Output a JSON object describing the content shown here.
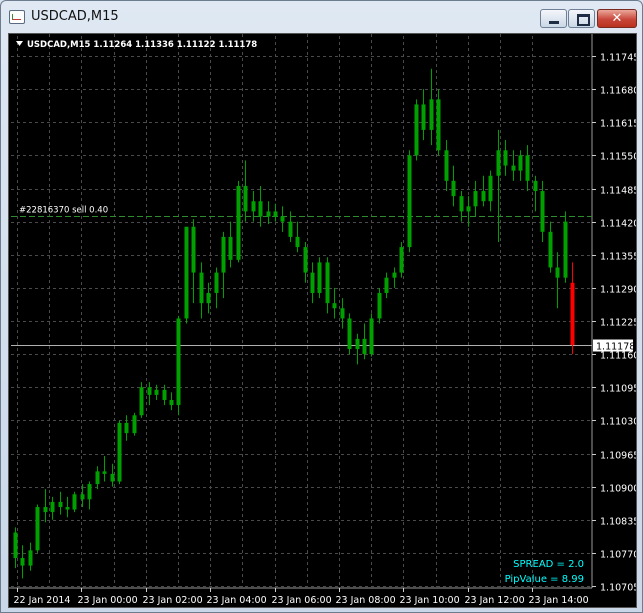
{
  "window": {
    "title": "USDCAD,M15"
  },
  "header": {
    "symbol_line": "USDCAD,M15  1.11264 1.11336 1.11122 1.11178"
  },
  "order_line": {
    "label": "#22816370 sell 0.40",
    "price": 1.11432
  },
  "bid_line": {
    "price": 1.11178,
    "label": "1.11178"
  },
  "info": {
    "spread": "SPREAD = 2.0",
    "pip_value": "PipValue = 8.99"
  },
  "colors": {
    "background": "#000000",
    "bull": "#00a000",
    "bear": "#00a000",
    "last_bear": "#ff0000",
    "grid": "#4a4a4a",
    "text": "#ffffff",
    "info": "#00ffff"
  },
  "chart_data": {
    "type": "candlestick",
    "y_ticks": [
      "1.11745",
      "1.11680",
      "1.11615",
      "1.11550",
      "1.11485",
      "1.11420",
      "1.11355",
      "1.11290",
      "1.11225",
      "1.11160",
      "1.11095",
      "1.11030",
      "1.10965",
      "1.10900",
      "1.10835",
      "1.10770",
      "1.10705"
    ],
    "x_ticks": [
      "22 Jan 2014",
      "23 Jan 00:00",
      "23 Jan 02:00",
      "23 Jan 04:00",
      "23 Jan 06:00",
      "23 Jan 08:00",
      "23 Jan 10:00",
      "23 Jan 12:00",
      "23 Jan 14:00"
    ],
    "ylim": [
      1.10705,
      1.11745
    ],
    "grid": true,
    "candles": [
      [
        1.1081,
        1.1082,
        1.1074,
        1.1076
      ],
      [
        1.1076,
        1.10785,
        1.1072,
        1.10745
      ],
      [
        1.10745,
        1.1079,
        1.10735,
        1.10775
      ],
      [
        1.10775,
        1.10865,
        1.1077,
        1.1086
      ],
      [
        1.1086,
        1.10895,
        1.1083,
        1.1085
      ],
      [
        1.1085,
        1.1088,
        1.10835,
        1.1087
      ],
      [
        1.1087,
        1.1089,
        1.10845,
        1.1086
      ],
      [
        1.1086,
        1.1088,
        1.1084,
        1.10855
      ],
      [
        1.10855,
        1.1089,
        1.1085,
        1.10885
      ],
      [
        1.10885,
        1.10905,
        1.1086,
        1.10875
      ],
      [
        1.10875,
        1.1091,
        1.10855,
        1.10905
      ],
      [
        1.10905,
        1.1094,
        1.10895,
        1.1093
      ],
      [
        1.1093,
        1.1096,
        1.1091,
        1.10925
      ],
      [
        1.10925,
        1.10945,
        1.109,
        1.1091
      ],
      [
        1.1091,
        1.1103,
        1.10905,
        1.11025
      ],
      [
        1.11025,
        1.1104,
        1.1099,
        1.11005
      ],
      [
        1.11005,
        1.11045,
        1.11,
        1.1104
      ],
      [
        1.1104,
        1.11105,
        1.11035,
        1.11095
      ],
      [
        1.11095,
        1.11105,
        1.1106,
        1.1108
      ],
      [
        1.1108,
        1.111,
        1.1107,
        1.1109
      ],
      [
        1.1109,
        1.111,
        1.1106,
        1.1107
      ],
      [
        1.1107,
        1.11085,
        1.1105,
        1.1106
      ],
      [
        1.1106,
        1.11235,
        1.1104,
        1.1123
      ],
      [
        1.1123,
        1.11305,
        1.1122,
        1.1141
      ],
      [
        1.1141,
        1.11425,
        1.1126,
        1.1132
      ],
      [
        1.1132,
        1.1134,
        1.1123,
        1.1126
      ],
      [
        1.1126,
        1.113,
        1.1124,
        1.1128
      ],
      [
        1.1128,
        1.1133,
        1.1125,
        1.1132
      ],
      [
        1.1132,
        1.114,
        1.1127,
        1.1139
      ],
      [
        1.1139,
        1.1142,
        1.1133,
        1.11345
      ],
      [
        1.11345,
        1.115,
        1.1134,
        1.1149
      ],
      [
        1.1149,
        1.1154,
        1.1142,
        1.1144
      ],
      [
        1.1144,
        1.1148,
        1.1142,
        1.1146
      ],
      [
        1.1146,
        1.1149,
        1.1141,
        1.1143
      ],
      [
        1.1143,
        1.1146,
        1.11415,
        1.1144
      ],
      [
        1.1144,
        1.11455,
        1.1142,
        1.1143
      ],
      [
        1.1143,
        1.1145,
        1.114,
        1.1142
      ],
      [
        1.1142,
        1.1144,
        1.1138,
        1.1139
      ],
      [
        1.1139,
        1.1142,
        1.1136,
        1.1137
      ],
      [
        1.1137,
        1.1138,
        1.113,
        1.1132
      ],
      [
        1.1132,
        1.1134,
        1.1126,
        1.1128
      ],
      [
        1.1128,
        1.1135,
        1.1127,
        1.1134
      ],
      [
        1.1134,
        1.1135,
        1.1124,
        1.1126
      ],
      [
        1.1126,
        1.1129,
        1.1123,
        1.1125
      ],
      [
        1.1125,
        1.1127,
        1.1121,
        1.1123
      ],
      [
        1.1123,
        1.1124,
        1.1116,
        1.1117
      ],
      [
        1.1117,
        1.112,
        1.1114,
        1.1119
      ],
      [
        1.1119,
        1.1122,
        1.1115,
        1.1116
      ],
      [
        1.1116,
        1.1124,
        1.11155,
        1.1123
      ],
      [
        1.1123,
        1.1129,
        1.1122,
        1.1128
      ],
      [
        1.1128,
        1.1132,
        1.1127,
        1.1131
      ],
      [
        1.1131,
        1.1133,
        1.1129,
        1.1132
      ],
      [
        1.1132,
        1.1138,
        1.1131,
        1.1137
      ],
      [
        1.1137,
        1.1156,
        1.1136,
        1.1155
      ],
      [
        1.1155,
        1.1166,
        1.1154,
        1.1165
      ],
      [
        1.1165,
        1.1168,
        1.1158,
        1.116
      ],
      [
        1.116,
        1.1172,
        1.1157,
        1.1166
      ],
      [
        1.1166,
        1.1168,
        1.1155,
        1.1156
      ],
      [
        1.1156,
        1.1158,
        1.1148,
        1.115
      ],
      [
        1.115,
        1.1153,
        1.1145,
        1.1147
      ],
      [
        1.1147,
        1.1148,
        1.1142,
        1.1144
      ],
      [
        1.1144,
        1.1147,
        1.1141,
        1.1145
      ],
      [
        1.1145,
        1.115,
        1.1143,
        1.1148
      ],
      [
        1.1148,
        1.1151,
        1.1145,
        1.1146
      ],
      [
        1.1146,
        1.1152,
        1.1144,
        1.1151
      ],
      [
        1.1151,
        1.116,
        1.1138,
        1.1156
      ],
      [
        1.1156,
        1.1158,
        1.1151,
        1.1153
      ],
      [
        1.1153,
        1.1156,
        1.115,
        1.1152
      ],
      [
        1.1152,
        1.1156,
        1.115,
        1.1155
      ],
      [
        1.1155,
        1.1157,
        1.1148,
        1.115
      ],
      [
        1.115,
        1.1151,
        1.1144,
        1.1148
      ],
      [
        1.1148,
        1.115,
        1.1138,
        1.114
      ],
      [
        1.114,
        1.1142,
        1.1132,
        1.1133
      ],
      [
        1.1133,
        1.1136,
        1.1125,
        1.1131
      ],
      [
        1.1131,
        1.1144,
        1.113,
        1.1142
      ],
      [
        1.113,
        1.1134,
        1.1116,
        1.11178
      ]
    ]
  }
}
